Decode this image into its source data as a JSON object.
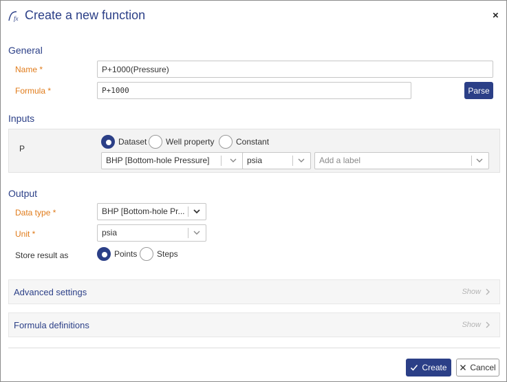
{
  "dialog": {
    "title": "Create a new function",
    "icon": "function-fx-icon",
    "close_label": "×"
  },
  "general": {
    "section_title": "General",
    "name_label": "Name",
    "name_value": "P+1000(Pressure)",
    "formula_label": "Formula",
    "formula_value": "P+1000",
    "parse_label": "Parse"
  },
  "inputs": {
    "section_title": "Inputs",
    "variable": "P",
    "source_options": [
      {
        "label": "Dataset",
        "selected": true
      },
      {
        "label": "Well property",
        "selected": false
      },
      {
        "label": "Constant",
        "selected": false
      }
    ],
    "dataset_value": "BHP [Bottom-hole Pressure]",
    "unit_value": "psia",
    "label_placeholder": "Add a label"
  },
  "output": {
    "section_title": "Output",
    "data_type_label": "Data type",
    "data_type_value": "BHP [Bottom-hole Pr...",
    "unit_label": "Unit",
    "unit_value": "psia",
    "store_label": "Store result as",
    "store_options": [
      {
        "label": "Points",
        "selected": true
      },
      {
        "label": "Steps",
        "selected": false
      }
    ]
  },
  "advanced": {
    "title": "Advanced settings",
    "show_label": "Show"
  },
  "definitions": {
    "title": "Formula definitions",
    "show_label": "Show"
  },
  "footer": {
    "create_label": "Create",
    "cancel_label": "Cancel"
  },
  "colors": {
    "accent": "#2b3f87",
    "required": "#e07b1a"
  }
}
